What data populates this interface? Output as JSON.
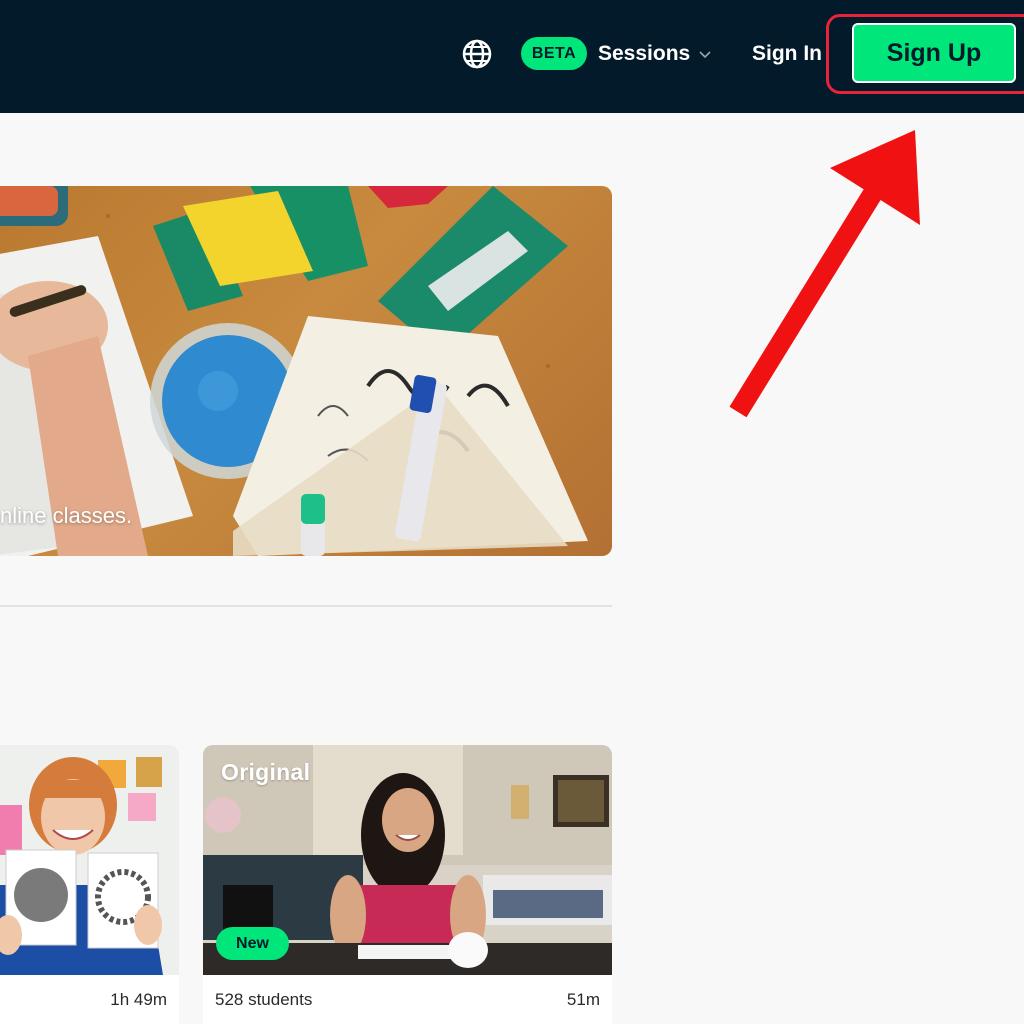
{
  "header": {
    "globe_icon": "globe-icon",
    "beta_label": "BETA",
    "sessions_label": "Sessions",
    "sign_in_label": "Sign In",
    "sign_up_label": "Sign Up"
  },
  "hero": {
    "tagline": "nline classes."
  },
  "cards": [
    {
      "label": "",
      "badge": "",
      "students": "",
      "duration": "1h 49m"
    },
    {
      "label": "Original",
      "badge": "New",
      "students": "528 students",
      "duration": "51m"
    }
  ],
  "colors": {
    "topbar": "#031a2a",
    "accent": "#00e67a",
    "annotation": "#e8243a"
  }
}
